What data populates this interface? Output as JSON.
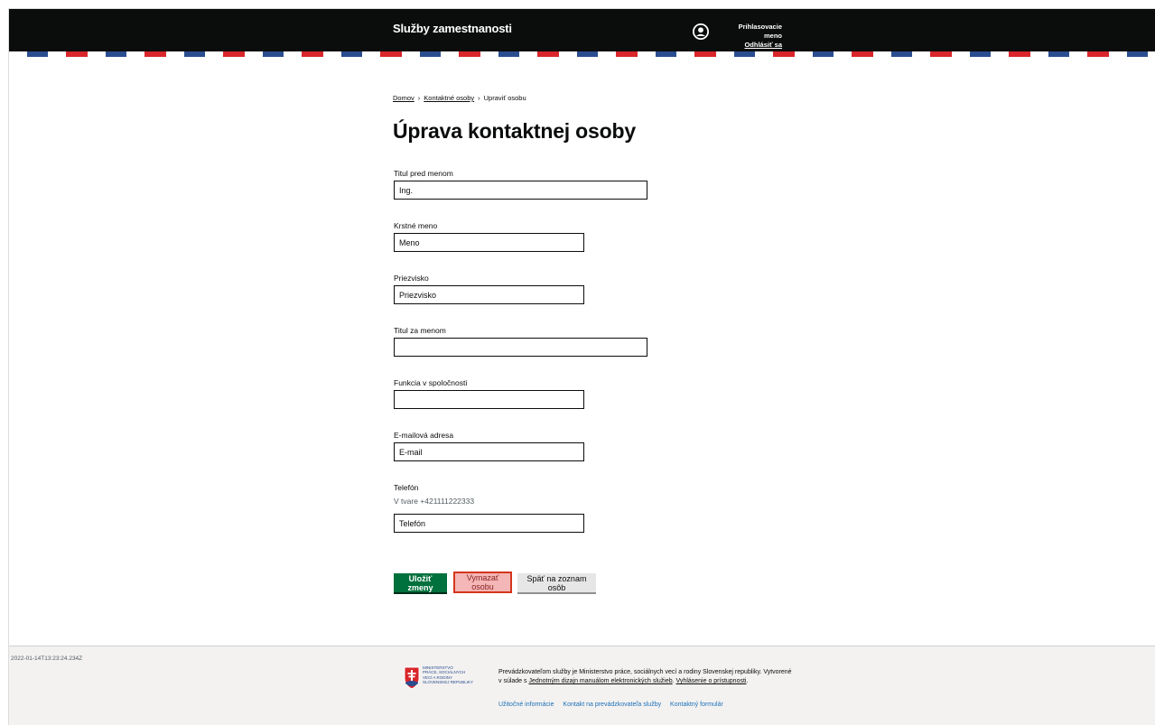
{
  "header": {
    "service_name": "Služby zamestnanosti",
    "login_name": "Prihlasovacie meno",
    "logout": "Odhlásiť sa"
  },
  "breadcrumb": [
    "Domov",
    "Kontaktné osoby",
    "Upraviť osobu"
  ],
  "page_title": "Úprava kontaktnej osoby",
  "form": {
    "title_before": {
      "label": "Titul pred menom",
      "value": "Ing."
    },
    "first_name": {
      "label": "Krstné meno",
      "value": "Meno"
    },
    "last_name": {
      "label": "Priezvisko",
      "value": "Priezvisko"
    },
    "title_after": {
      "label": "Titul za menom",
      "value": ""
    },
    "position": {
      "label": "Funkcia v spoločnosti",
      "value": ""
    },
    "email": {
      "label": "E-mailová adresa",
      "value": "E-mail"
    },
    "phone": {
      "label": "Telefón",
      "hint": "V tvare +421111222333",
      "value": "Telefón"
    }
  },
  "buttons": {
    "save": "Uložiť zmeny",
    "delete": "Vymazať osobu",
    "back": "Späť na zoznam osôb"
  },
  "footer": {
    "timestamp": "2022-01-14T13:23:24.234Z",
    "logo_lines": [
      "MINISTERSTVO",
      "PRÁCE, SOCIÁLNYCH",
      "VECÍ A RODINY",
      "SLOVENSKEJ REPUBLIKY"
    ],
    "operator_text": "Prevádzkovateľom služby je Ministerstvo práce, sociálnych vecí a rodiny Slovenskej republiky. Vytvorené v súlade s",
    "manual_link": "Jednotným dizajn manuálom elektronických služieb",
    "accessibility_link": "Vyhlásenie o prístupnosti",
    "links": [
      "Užitočné informácie",
      "Kontakt na prevádzkovateľa služby",
      "Kontaktný formulár"
    ]
  },
  "colors": {
    "header_bg": "#0b0c0c",
    "save_button": "#00703c",
    "delete_button_border": "#d4351c",
    "stripe_blue": "#2a4d8f",
    "stripe_red": "#d8262b"
  }
}
